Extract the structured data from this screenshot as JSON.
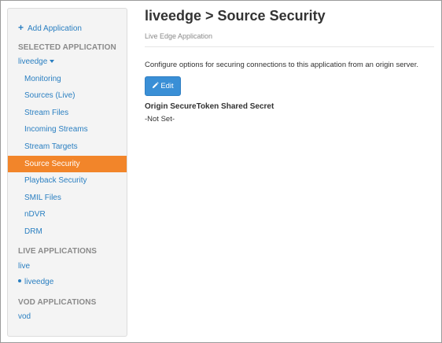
{
  "sidebar": {
    "add_application": "Add Application",
    "selected_section": "SELECTED APPLICATION",
    "selected_app": "liveedge",
    "items": [
      {
        "label": "Monitoring"
      },
      {
        "label": "Sources (Live)"
      },
      {
        "label": "Stream Files"
      },
      {
        "label": "Incoming Streams"
      },
      {
        "label": "Stream Targets"
      },
      {
        "label": "Source Security",
        "active": true
      },
      {
        "label": "Playback Security"
      },
      {
        "label": "SMIL Files"
      },
      {
        "label": "nDVR"
      },
      {
        "label": "DRM"
      }
    ],
    "live_section": "LIVE APPLICATIONS",
    "live_apps": [
      "live",
      "liveedge"
    ],
    "vod_section": "VOD APPLICATIONS",
    "vod_apps": [
      "vod"
    ]
  },
  "main": {
    "title": "liveedge > Source Security",
    "subtitle": "Live Edge Application",
    "description": "Configure options for securing connections to this application from an origin server.",
    "edit_label": "Edit",
    "field_label": "Origin SecureToken Shared Secret",
    "field_value": "-Not Set-"
  },
  "colors": {
    "accent": "#f2852a",
    "link": "#2a7fc1",
    "button": "#3a8fd6"
  },
  "icons": [
    "plus-icon",
    "caret-down-icon",
    "pencil-icon",
    "bullet-icon"
  ]
}
